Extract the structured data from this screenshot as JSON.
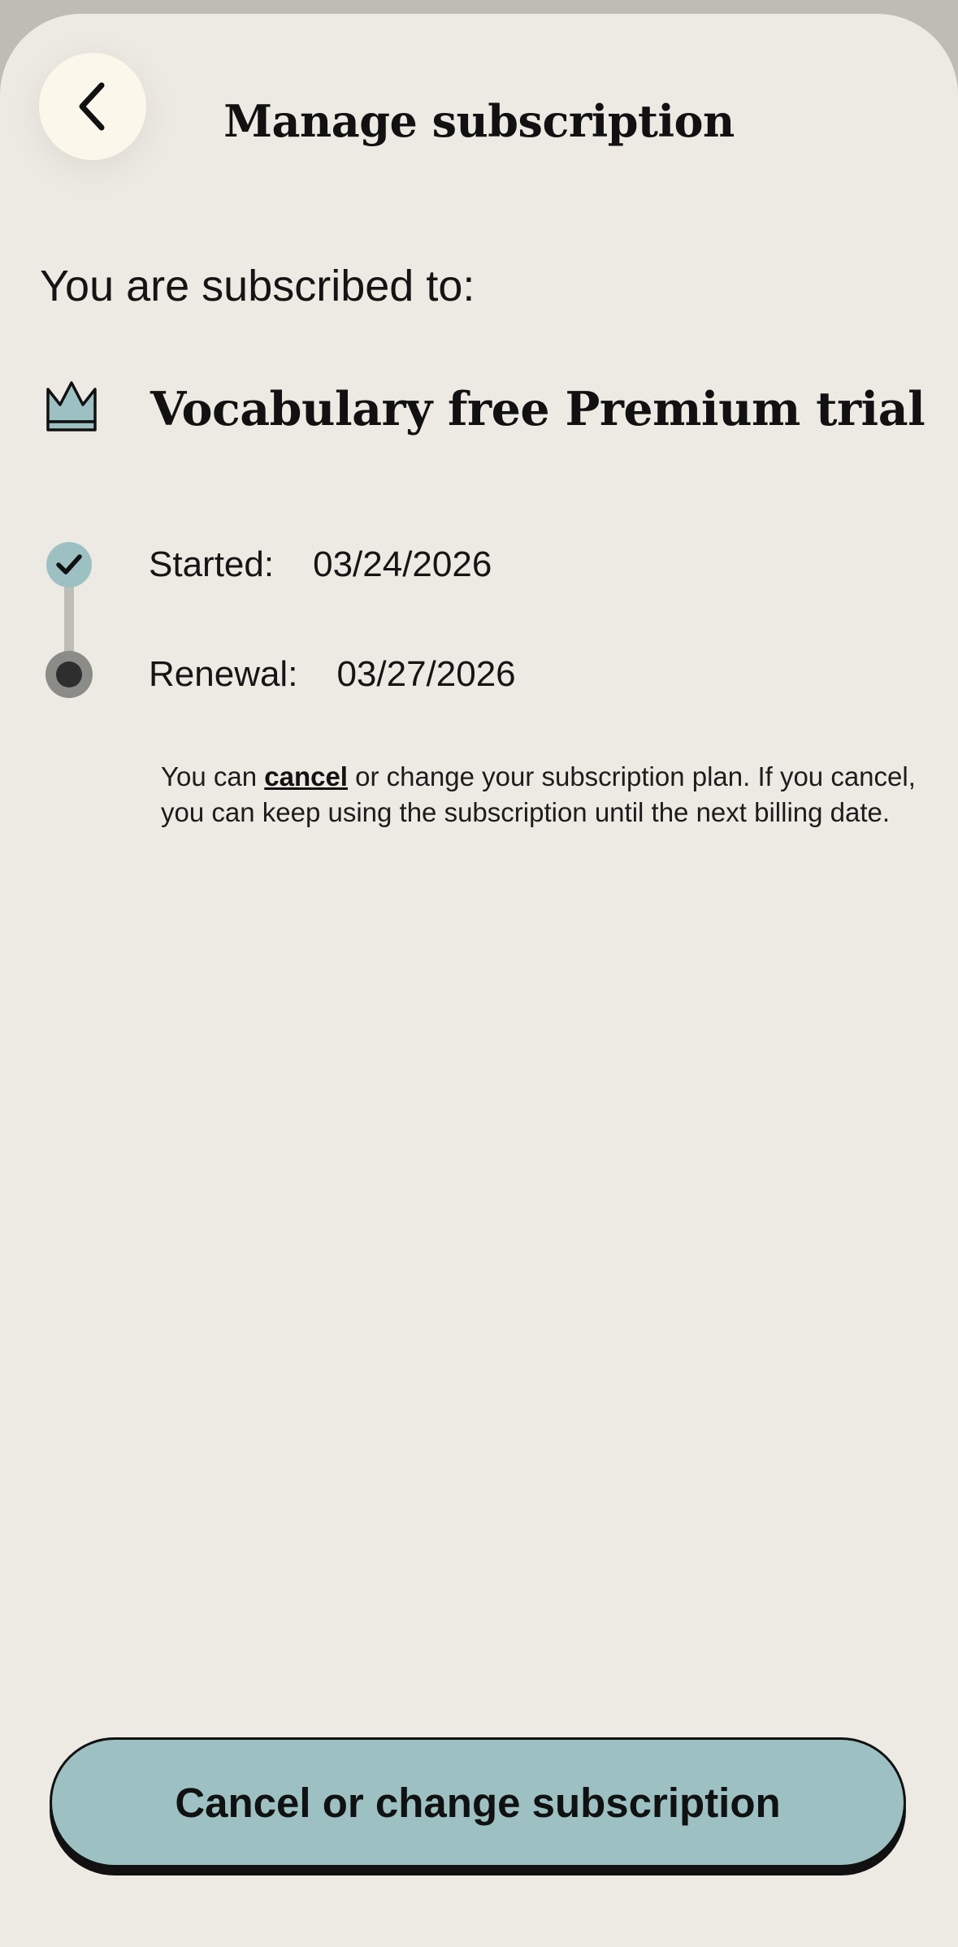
{
  "header": {
    "title": "Manage subscription",
    "back_icon": "chevron-left-icon"
  },
  "subscription": {
    "intro_label": "You are subscribed to:",
    "plan_icon": "crown-icon",
    "plan_name": "Vocabulary free Premium trial"
  },
  "timeline": {
    "started": {
      "label": "Started:",
      "date": "03/24/2026",
      "icon": "check-icon"
    },
    "renewal": {
      "label": "Renewal:",
      "date": "03/27/2026",
      "icon": "dot-icon"
    }
  },
  "info": {
    "prefix": "You can ",
    "link": "cancel",
    "suffix": " or change your subscription plan. If you cancel, you can keep using the subscription until the next billing date."
  },
  "footer": {
    "primary_button_label": "Cancel or change subscription"
  },
  "colors": {
    "background": "#edeae3",
    "accent": "#9dc1c2",
    "back_button_bg": "#fbf7ea",
    "text": "#111111"
  }
}
